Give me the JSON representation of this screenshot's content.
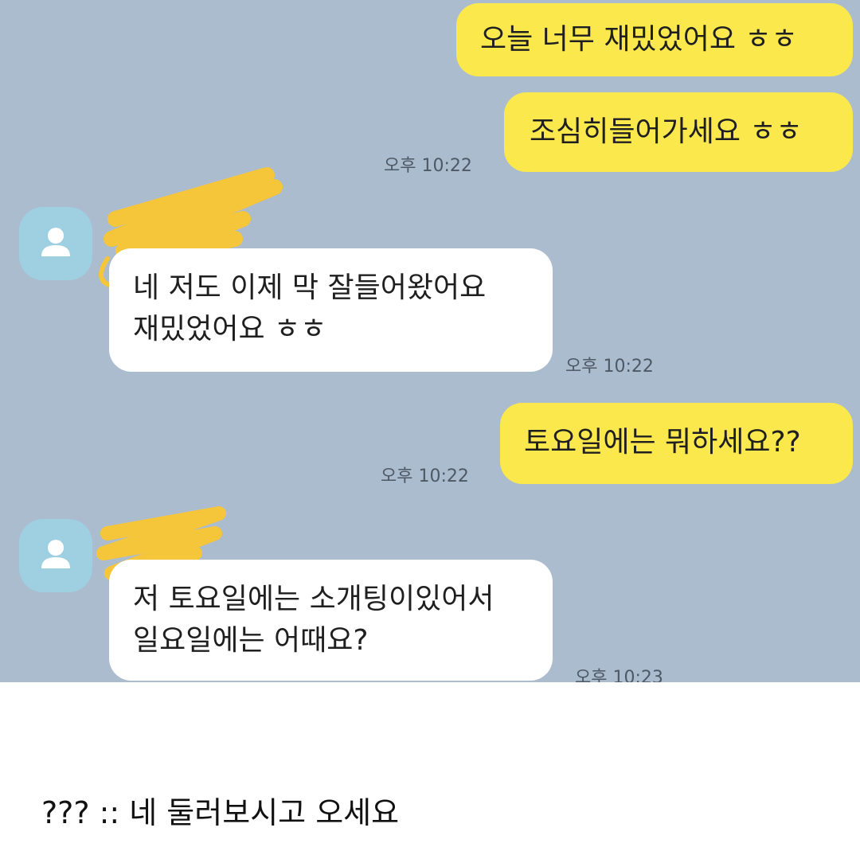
{
  "messages": [
    {
      "lines": [
        "오늘 너무 재밌었어요 ㅎㅎ"
      ]
    },
    {
      "lines": [
        "조심히들어가세요 ㅎㅎ"
      ],
      "time": "오후 10:22"
    },
    {
      "lines": [
        "네 저도 이제 막 잘들어왔어요",
        "재밌었어요 ㅎㅎ"
      ],
      "time": "오후 10:22"
    },
    {
      "lines": [
        "토요일에는 뭐하세요??"
      ],
      "time": "오후 10:22"
    },
    {
      "lines": [
        "저 토요일에는 소개팅이있어서",
        "일요일에는 어때요?"
      ],
      "time": "오후 10:23"
    }
  ],
  "caption": "??? :: 네 둘러보시고 오세요",
  "colors": {
    "chat_background": "#acbccf",
    "my_bubble": "#fae84d",
    "their_bubble": "#ffffff",
    "avatar": "#9fd0e2",
    "redaction_scribble": "#f5c53a"
  },
  "icons": [
    "person-icon",
    "redaction-scribble"
  ]
}
